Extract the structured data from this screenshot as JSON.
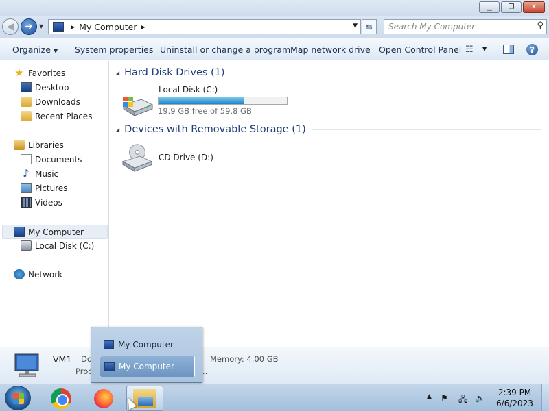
{
  "window": {
    "buttons": {
      "minimize_icon": "minimize-icon",
      "restore_icon": "restore-icon",
      "close_icon": "close-icon"
    }
  },
  "address": {
    "location": "My Computer",
    "search_placeholder": "Search My Computer"
  },
  "toolbar": {
    "organize": "Organize",
    "system_properties": "System properties",
    "uninstall": "Uninstall or change a program",
    "map_network": "Map network drive",
    "open_control_panel": "Open Control Panel"
  },
  "sidebar": {
    "items": [
      {
        "label": "Favorites",
        "icon": "star-icon"
      },
      {
        "label": "Desktop",
        "icon": "desktop-icon"
      },
      {
        "label": "Downloads",
        "icon": "downloads-icon"
      },
      {
        "label": "Recent Places",
        "icon": "recent-places-icon"
      },
      {
        "label": "Libraries",
        "icon": "libraries-icon"
      },
      {
        "label": "Documents",
        "icon": "documents-icon"
      },
      {
        "label": "Music",
        "icon": "music-icon"
      },
      {
        "label": "Pictures",
        "icon": "pictures-icon"
      },
      {
        "label": "Videos",
        "icon": "videos-icon"
      },
      {
        "label": "My Computer",
        "icon": "computer-icon",
        "selected": true
      },
      {
        "label": "Local Disk (C:)",
        "icon": "disk-icon"
      },
      {
        "label": "Network",
        "icon": "network-icon"
      }
    ]
  },
  "content": {
    "groups": [
      {
        "title": "Hard Disk Drives (1)"
      },
      {
        "title": "Devices with Removable Storage (1)"
      }
    ],
    "drives": [
      {
        "name": "Local Disk (C:)",
        "free_text": "19.9 GB free of 59.8 GB",
        "used_fraction": 0.667,
        "bar_color": "#1e86c7"
      },
      {
        "name": "CD Drive (D:)"
      }
    ]
  },
  "details": {
    "name": "VM1",
    "trunc_domain": "Do",
    "trunc_proc": "Proc",
    "memory": "Memory: 4.00 GB",
    "dots": ".."
  },
  "popup": {
    "items": [
      {
        "label": "My Computer"
      },
      {
        "label": "My Computer"
      }
    ]
  },
  "taskbar": {
    "time": "2:39 PM",
    "date": "6/6/2023",
    "apps": [
      "chrome-icon",
      "firefox-icon",
      "windows-explorer-icon"
    ]
  }
}
